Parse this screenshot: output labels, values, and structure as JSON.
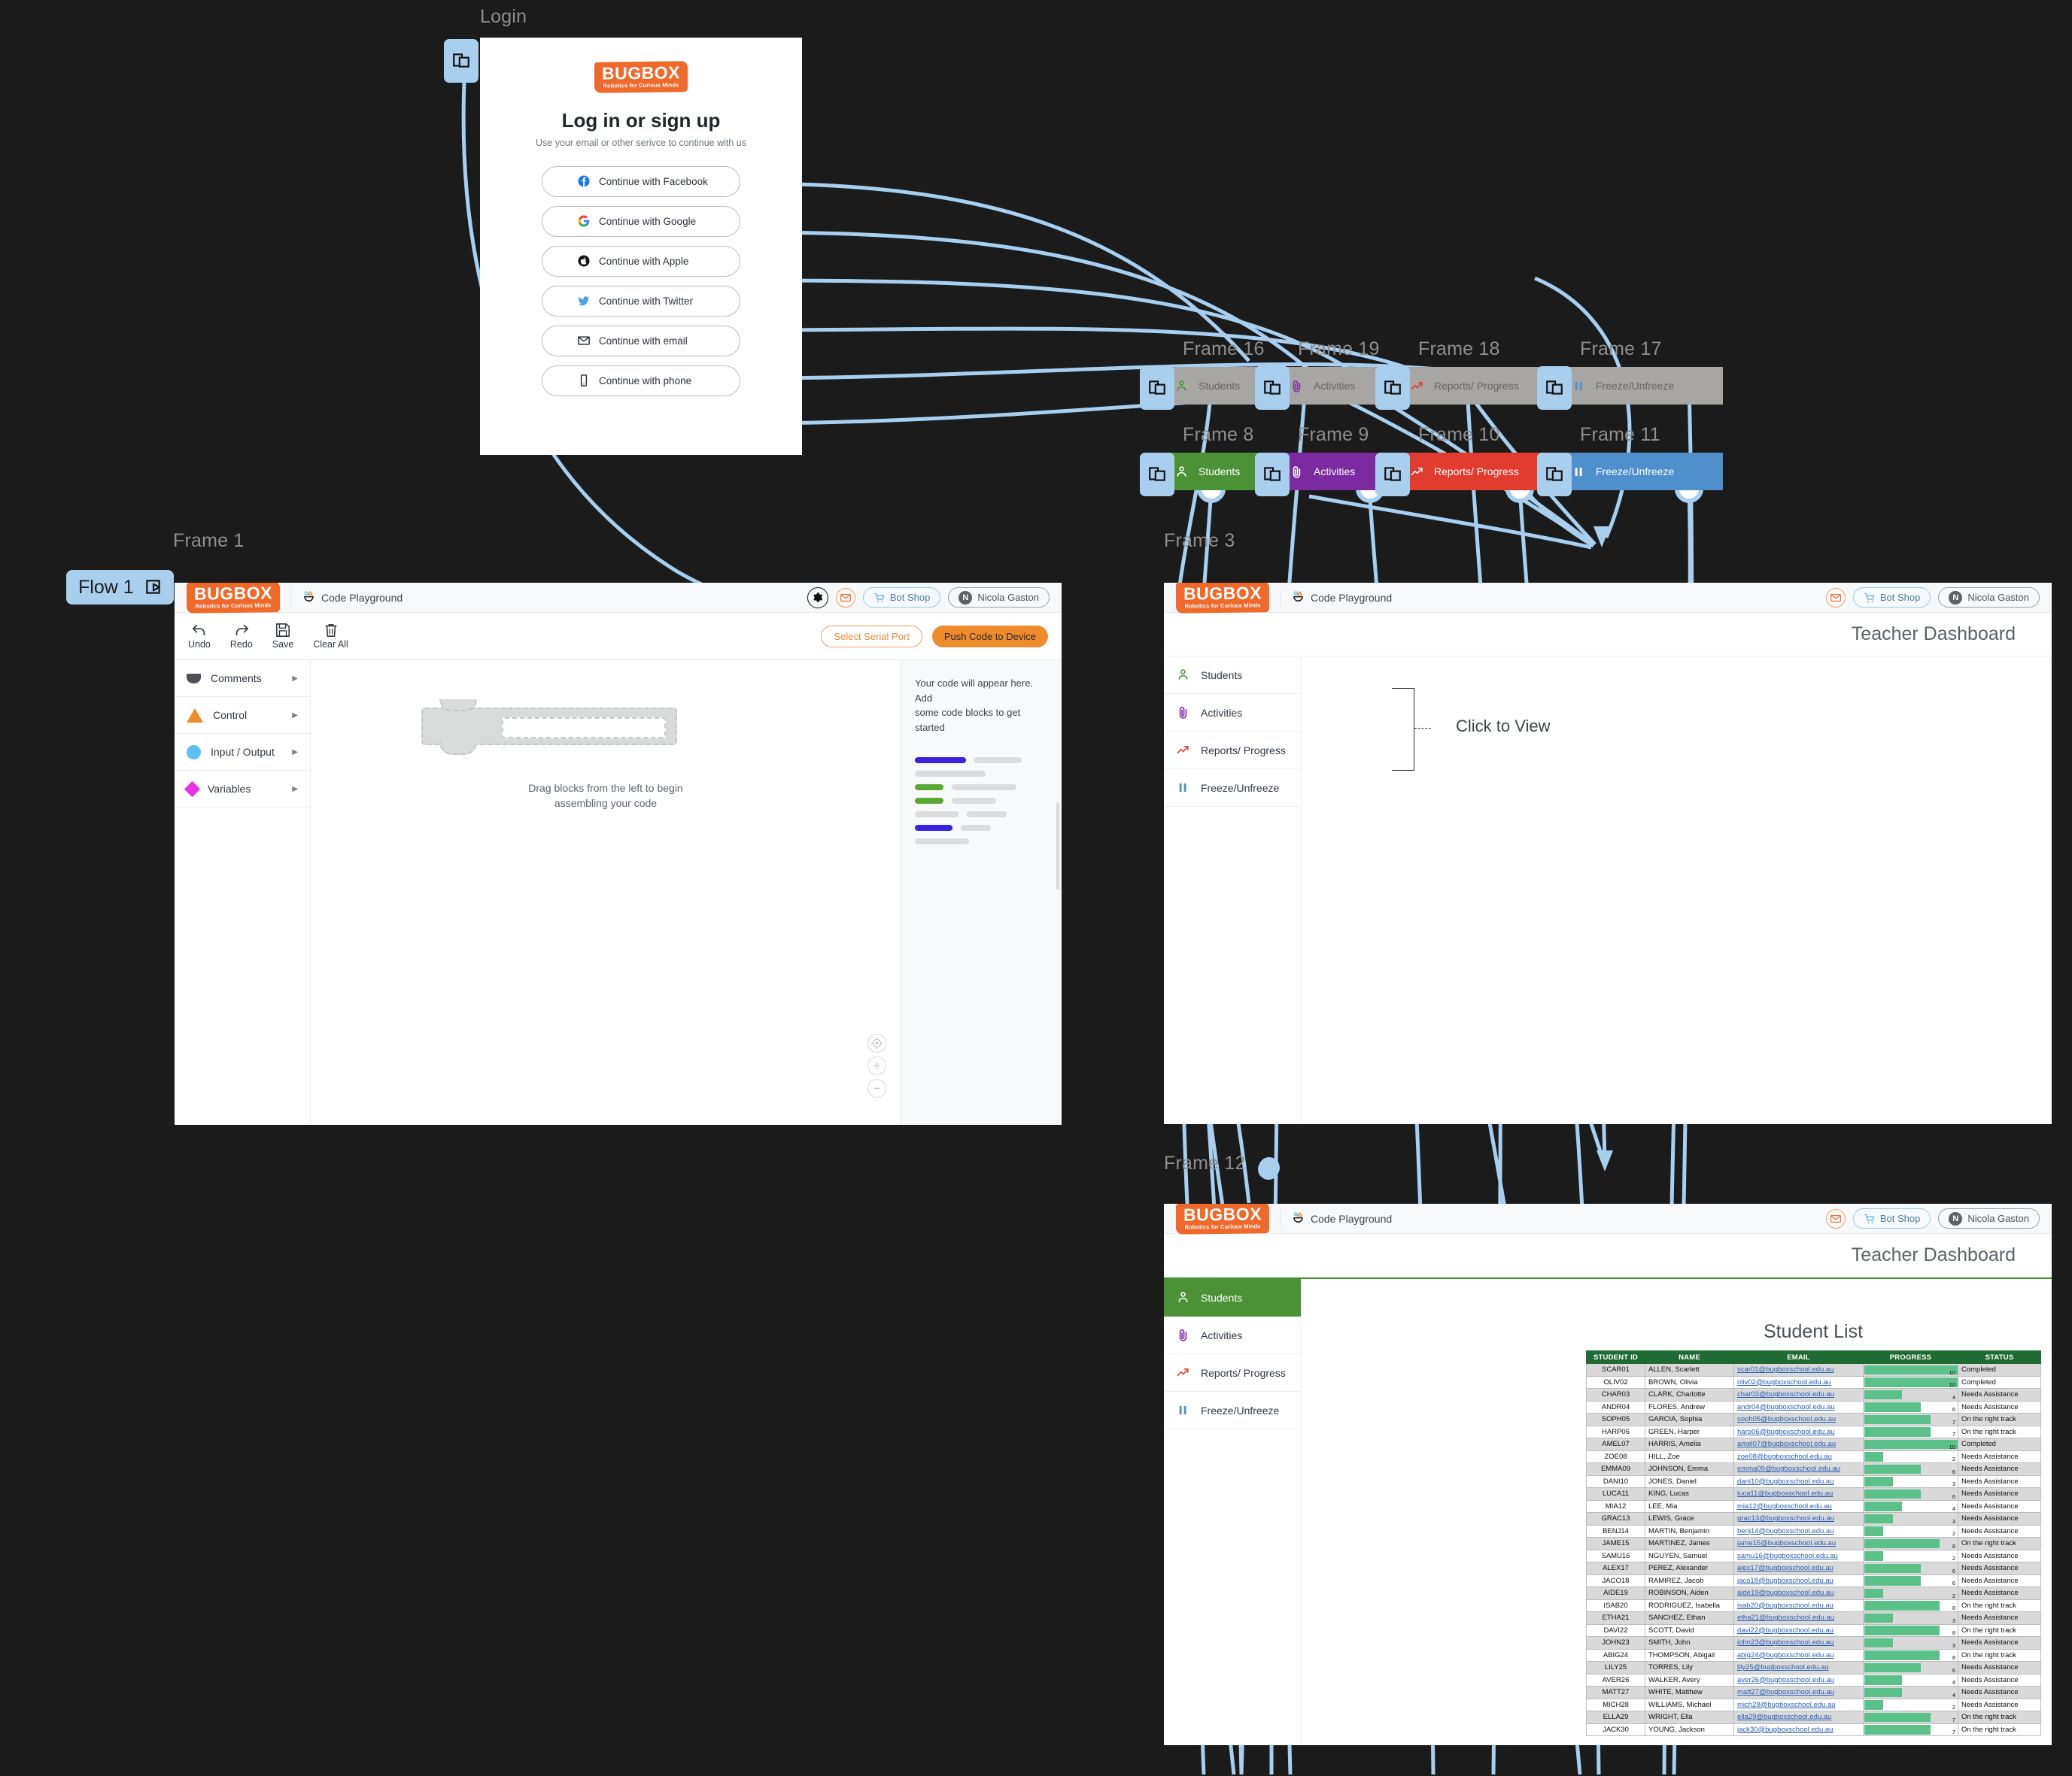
{
  "board": {
    "flow_label": "Flow 1",
    "login_label": "Login",
    "frame_labels": {
      "f1": "Frame 1",
      "f3": "Frame 3",
      "f12": "Frame 12",
      "f16": "Frame 16",
      "f19": "Frame 19",
      "f18": "Frame 18",
      "f17": "Frame 17",
      "f8": "Frame 8",
      "f9": "Frame 9",
      "f10": "Frame 10",
      "f11": "Frame 11"
    },
    "colors": {
      "wire": "#a9cfef",
      "brand_orange": "#ef6a2a",
      "accent_green": "#4a9235",
      "accent_purple": "#7b2aa0",
      "accent_red": "#e23b30",
      "accent_blue": "#4f8fcc",
      "canvas_bg": "#1b1b1b"
    }
  },
  "login": {
    "brand_top": "BUGBOX",
    "brand_sub": "Robotics for Curious Minds",
    "heading": "Log in or sign up",
    "subheading": "Use your email or other serivce to continue with us",
    "buttons": [
      {
        "label": "Continue with Facebook",
        "icon": "facebook-icon"
      },
      {
        "label": "Continue with Google",
        "icon": "google-icon"
      },
      {
        "label": "Continue with Apple",
        "icon": "apple-icon"
      },
      {
        "label": "Continue with Twitter",
        "icon": "twitter-icon"
      },
      {
        "label": "Continue with email",
        "icon": "envelope-icon"
      },
      {
        "label": "Continue with phone",
        "icon": "phone-icon"
      }
    ]
  },
  "playground": {
    "brand_top": "BUGBOX",
    "brand_sub": "Robotics for Curious Minds",
    "page_title": "Code Playground",
    "topbar": {
      "mail_icon": "envelope-icon",
      "gear_icon": "gear-icon",
      "shop_label": "Bot Shop",
      "user_name": "Nicola Gaston",
      "user_initial": "N"
    },
    "tools": [
      {
        "label": "Undo",
        "icon": "undo-icon"
      },
      {
        "label": "Redo",
        "icon": "redo-icon"
      },
      {
        "label": "Save",
        "icon": "floppy-disk-icon"
      },
      {
        "label": "Clear All",
        "icon": "trash-icon"
      }
    ],
    "actions": {
      "serial": "Select Serial Port",
      "push": "Push Code to Device"
    },
    "categories": [
      {
        "label": "Comments",
        "swatch": "comments",
        "icon": "comment-swatch-icon"
      },
      {
        "label": "Control",
        "swatch": "control",
        "icon": "triangle-swatch-icon"
      },
      {
        "label": "Input / Output",
        "swatch": "io",
        "icon": "circle-swatch-icon"
      },
      {
        "label": "Variables",
        "swatch": "vars",
        "icon": "diamond-swatch-icon"
      }
    ],
    "drag_hint_line1": "Drag blocks from the left to begin",
    "drag_hint_line2": "assembling your code",
    "code_hint_line1": "Your code will appear here. Add",
    "code_hint_line2": "some code blocks to get started",
    "zoom_controls": [
      {
        "icon": "recenter-icon",
        "glyph": "☉"
      },
      {
        "icon": "zoom-in-icon",
        "glyph": "+"
      },
      {
        "icon": "zoom-out-icon",
        "glyph": "−"
      }
    ]
  },
  "dashboard": {
    "title": "Teacher Dashboard",
    "click_to_view": "Click to View",
    "nav": [
      {
        "label": "Students",
        "icon": "person-icon",
        "color": "#4a9235"
      },
      {
        "label": "Activities",
        "icon": "paperclip-icon",
        "color": "#7b2aa0"
      },
      {
        "label": "Reports/ Progress",
        "icon": "trend-up-icon",
        "color": "#e23b30"
      },
      {
        "label": "Freeze/Unfreeze",
        "icon": "pause-icon",
        "color": "#4f8fcc"
      }
    ]
  },
  "nav_frames": {
    "row_top": [
      {
        "frame": "Frame 16",
        "label": "Students",
        "icon": "person-icon"
      },
      {
        "frame": "Frame 19",
        "label": "Activities",
        "icon": "paperclip-icon"
      },
      {
        "frame": "Frame 18",
        "label": "Reports/ Progress",
        "icon": "trend-up-icon"
      },
      {
        "frame": "Frame 17",
        "label": "Freeze/Unfreeze",
        "icon": "pause-icon"
      }
    ],
    "row_bottom": [
      {
        "frame": "Frame 8",
        "label": "Students",
        "icon": "person-icon",
        "bg": "#4a9235"
      },
      {
        "frame": "Frame 9",
        "label": "Activities",
        "icon": "paperclip-icon",
        "bg": "#7b2aa0"
      },
      {
        "frame": "Frame 10",
        "label": "Reports/ Progress",
        "icon": "trend-up-icon",
        "bg": "#e23b30"
      },
      {
        "frame": "Frame 11",
        "label": "Freeze/Unfreeze",
        "icon": "pause-icon",
        "bg": "#4f8fcc"
      }
    ]
  },
  "student_list": {
    "title": "Student List",
    "columns": [
      "STUDENT ID",
      "NAME",
      "EMAIL",
      "PROGRESS",
      "STATUS"
    ],
    "progress_max": 10,
    "rows": [
      {
        "id": "SCAR01",
        "name": "ALLEN, Scarlett",
        "email": "scar01@bugboxschool.edu.au",
        "progress": 10,
        "status": "Completed"
      },
      {
        "id": "OLIV02",
        "name": "BROWN, Olivia",
        "email": "oliv02@bugboxschool.edu.au",
        "progress": 10,
        "status": "Completed"
      },
      {
        "id": "CHAR03",
        "name": "CLARK, Charlotte",
        "email": "char03@bugboxschool.edu.au",
        "progress": 4,
        "status": "Needs Assistance"
      },
      {
        "id": "ANDR04",
        "name": "FLORES, Andrew",
        "email": "andr04@bugboxschool.edu.au",
        "progress": 6,
        "status": "Needs Assistance"
      },
      {
        "id": "SOPH05",
        "name": "GARCIA, Sophia",
        "email": "soph05@bugboxschool.edu.au",
        "progress": 7,
        "status": "On the right track"
      },
      {
        "id": "HARP06",
        "name": "GREEN, Harper",
        "email": "harp06@bugboxschool.edu.au",
        "progress": 7,
        "status": "On the right track"
      },
      {
        "id": "AMEL07",
        "name": "HARRIS, Amelia",
        "email": "amel07@bugboxschool.edu.au",
        "progress": 10,
        "status": "Completed"
      },
      {
        "id": "ZOE08",
        "name": "HILL, Zoe",
        "email": "zoe08@bugboxschool.edu.au",
        "progress": 2,
        "status": "Needs Assistance"
      },
      {
        "id": "EMMA09",
        "name": "JOHNSON, Emma",
        "email": "emma09@bugboxschool.edu.au",
        "progress": 6,
        "status": "Needs Assistance"
      },
      {
        "id": "DANI10",
        "name": "JONES, Daniel",
        "email": "dani10@bugboxschool.edu.au",
        "progress": 3,
        "status": "Needs Assistance"
      },
      {
        "id": "LUCA11",
        "name": "KING, Lucas",
        "email": "luca11@bugboxschool.edu.au",
        "progress": 6,
        "status": "Needs Assistance"
      },
      {
        "id": "MIA12",
        "name": "LEE, Mia",
        "email": "mia12@bugboxschool.edu.au",
        "progress": 4,
        "status": "Needs Assistance"
      },
      {
        "id": "GRAC13",
        "name": "LEWIS, Grace",
        "email": "grac13@bugboxschool.edu.au",
        "progress": 3,
        "status": "Needs Assistance"
      },
      {
        "id": "BENJ14",
        "name": "MARTIN, Benjamin",
        "email": "benj14@bugboxschool.edu.au",
        "progress": 2,
        "status": "Needs Assistance"
      },
      {
        "id": "JAME15",
        "name": "MARTINEZ, James",
        "email": "jame15@bugboxschool.edu.au",
        "progress": 8,
        "status": "On the right track"
      },
      {
        "id": "SAMU16",
        "name": "NGUYEN, Samuel",
        "email": "samu16@bugboxschool.edu.au",
        "progress": 2,
        "status": "Needs Assistance"
      },
      {
        "id": "ALEX17",
        "name": "PEREZ, Alexander",
        "email": "alex17@bugboxschool.edu.au",
        "progress": 6,
        "status": "Needs Assistance"
      },
      {
        "id": "JACO18",
        "name": "RAMIREZ, Jacob",
        "email": "jaco18@bugboxschool.edu.au",
        "progress": 6,
        "status": "Needs Assistance"
      },
      {
        "id": "AIDE19",
        "name": "ROBINSON, Aiden",
        "email": "aide19@bugboxschool.edu.au",
        "progress": 2,
        "status": "Needs Assistance"
      },
      {
        "id": "ISAB20",
        "name": "RODRIGUEZ, Isabella",
        "email": "isab20@bugboxschool.edu.au",
        "progress": 8,
        "status": "On the right track"
      },
      {
        "id": "ETHA21",
        "name": "SANCHEZ, Ethan",
        "email": "etha21@bugboxschool.edu.au",
        "progress": 3,
        "status": "Needs Assistance"
      },
      {
        "id": "DAVI22",
        "name": "SCOTT, David",
        "email": "davi22@bugboxschool.edu.au",
        "progress": 8,
        "status": "On the right track"
      },
      {
        "id": "JOHN23",
        "name": "SMITH, John",
        "email": "john23@bugboxschool.edu.au",
        "progress": 3,
        "status": "Needs Assistance"
      },
      {
        "id": "ABIG24",
        "name": "THOMPSON, Abigail",
        "email": "abig24@bugboxschool.edu.au",
        "progress": 8,
        "status": "On the right track"
      },
      {
        "id": "LILY25",
        "name": "TORRES, Lily",
        "email": "lily25@bugboxschool.edu.au",
        "progress": 6,
        "status": "Needs Assistance"
      },
      {
        "id": "AVER26",
        "name": "WALKER, Avery",
        "email": "aver26@bugboxschool.edu.au",
        "progress": 4,
        "status": "Needs Assistance"
      },
      {
        "id": "MATT27",
        "name": "WHITE, Matthew",
        "email": "matt27@bugboxschool.edu.au",
        "progress": 4,
        "status": "Needs Assistance"
      },
      {
        "id": "MICH28",
        "name": "WILLIAMS, Michael",
        "email": "mich28@bugboxschool.edu.au",
        "progress": 2,
        "status": "Needs Assistance"
      },
      {
        "id": "ELLA29",
        "name": "WRIGHT, Ella",
        "email": "ella29@bugboxschool.edu.au",
        "progress": 7,
        "status": "On the right track"
      },
      {
        "id": "JACK30",
        "name": "YOUNG, Jackson",
        "email": "jack30@bugboxschool.edu.au",
        "progress": 7,
        "status": "On the right track"
      }
    ]
  }
}
